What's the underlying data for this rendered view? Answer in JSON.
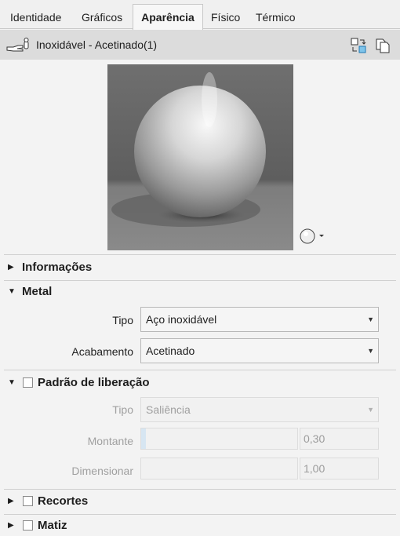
{
  "tabs": [
    {
      "label": "Identidade",
      "active": false
    },
    {
      "label": "Gráficos",
      "active": false
    },
    {
      "label": "Aparência",
      "active": true
    },
    {
      "label": "Físico",
      "active": false
    },
    {
      "label": "Térmico",
      "active": false
    }
  ],
  "material": {
    "name": "Inoxidável - Acetinado(1)",
    "icons": [
      "material-hand-icon",
      "replace-material-icon",
      "duplicate-material-icon"
    ]
  },
  "preview": {
    "shape_menu_icon": "sphere-icon"
  },
  "sections": {
    "info": {
      "label": "Informações",
      "expanded": false
    },
    "metal": {
      "label": "Metal",
      "expanded": true,
      "tipo_label": "Tipo",
      "tipo_value": "Aço inoxidável",
      "acabamento_label": "Acabamento",
      "acabamento_value": "Acetinado"
    },
    "pattern": {
      "label": "Padrão de liberação",
      "expanded": true,
      "enabled": false,
      "tipo_label": "Tipo",
      "tipo_value": "Saliência",
      "montante_label": "Montante",
      "montante_value": "0,30",
      "montante_fraction": 0.3,
      "dimensionar_label": "Dimensionar",
      "dimensionar_value": "1,00"
    },
    "cutouts": {
      "label": "Recortes",
      "expanded": false,
      "enabled": false
    },
    "tint": {
      "label": "Matiz",
      "expanded": false,
      "enabled": false
    }
  },
  "colors": {
    "accent_fill": "#d7e6f2",
    "header_bg": "#dcdcdc"
  }
}
